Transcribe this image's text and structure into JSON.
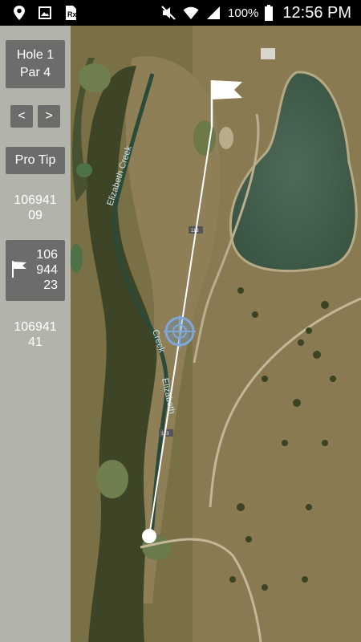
{
  "status_bar": {
    "left_icons": [
      "location-icon",
      "image-icon",
      "rx-icon"
    ],
    "right_icons": [
      "mute-icon",
      "wifi-icon",
      "signal-icon"
    ],
    "battery": "100%",
    "time": "12:56 PM"
  },
  "hole": {
    "number_label": "Hole 1",
    "par_label": "Par 4"
  },
  "nav": {
    "prev_label": "<",
    "next_label": ">"
  },
  "pro_tip_label": "Pro Tip",
  "distances": {
    "top_line1": "106941",
    "top_line2": "09",
    "flag_line1": "106",
    "flag_line2": "944",
    "flag_line3": "23",
    "bottom_line1": "106941",
    "bottom_line2": "41"
  },
  "map": {
    "creek_label_1": "Elizabeth Creek",
    "creek_label_2": "Creek",
    "creek_label_3": "Elizabeth",
    "cart_path_marker_1": "113",
    "cart_path_marker_2": "113"
  }
}
